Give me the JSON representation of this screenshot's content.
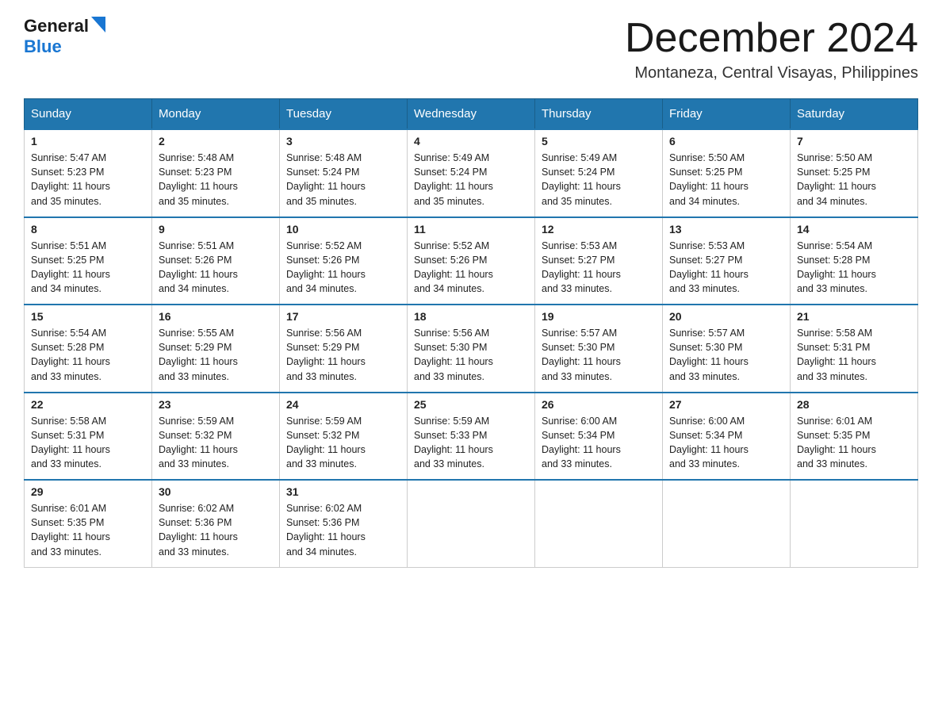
{
  "header": {
    "logo_general": "General",
    "logo_blue": "Blue",
    "month_title": "December 2024",
    "location": "Montaneza, Central Visayas, Philippines"
  },
  "weekdays": [
    "Sunday",
    "Monday",
    "Tuesday",
    "Wednesday",
    "Thursday",
    "Friday",
    "Saturday"
  ],
  "weeks": [
    [
      {
        "day": "1",
        "info": "Sunrise: 5:47 AM\nSunset: 5:23 PM\nDaylight: 11 hours\nand 35 minutes."
      },
      {
        "day": "2",
        "info": "Sunrise: 5:48 AM\nSunset: 5:23 PM\nDaylight: 11 hours\nand 35 minutes."
      },
      {
        "day": "3",
        "info": "Sunrise: 5:48 AM\nSunset: 5:24 PM\nDaylight: 11 hours\nand 35 minutes."
      },
      {
        "day": "4",
        "info": "Sunrise: 5:49 AM\nSunset: 5:24 PM\nDaylight: 11 hours\nand 35 minutes."
      },
      {
        "day": "5",
        "info": "Sunrise: 5:49 AM\nSunset: 5:24 PM\nDaylight: 11 hours\nand 35 minutes."
      },
      {
        "day": "6",
        "info": "Sunrise: 5:50 AM\nSunset: 5:25 PM\nDaylight: 11 hours\nand 34 minutes."
      },
      {
        "day": "7",
        "info": "Sunrise: 5:50 AM\nSunset: 5:25 PM\nDaylight: 11 hours\nand 34 minutes."
      }
    ],
    [
      {
        "day": "8",
        "info": "Sunrise: 5:51 AM\nSunset: 5:25 PM\nDaylight: 11 hours\nand 34 minutes."
      },
      {
        "day": "9",
        "info": "Sunrise: 5:51 AM\nSunset: 5:26 PM\nDaylight: 11 hours\nand 34 minutes."
      },
      {
        "day": "10",
        "info": "Sunrise: 5:52 AM\nSunset: 5:26 PM\nDaylight: 11 hours\nand 34 minutes."
      },
      {
        "day": "11",
        "info": "Sunrise: 5:52 AM\nSunset: 5:26 PM\nDaylight: 11 hours\nand 34 minutes."
      },
      {
        "day": "12",
        "info": "Sunrise: 5:53 AM\nSunset: 5:27 PM\nDaylight: 11 hours\nand 33 minutes."
      },
      {
        "day": "13",
        "info": "Sunrise: 5:53 AM\nSunset: 5:27 PM\nDaylight: 11 hours\nand 33 minutes."
      },
      {
        "day": "14",
        "info": "Sunrise: 5:54 AM\nSunset: 5:28 PM\nDaylight: 11 hours\nand 33 minutes."
      }
    ],
    [
      {
        "day": "15",
        "info": "Sunrise: 5:54 AM\nSunset: 5:28 PM\nDaylight: 11 hours\nand 33 minutes."
      },
      {
        "day": "16",
        "info": "Sunrise: 5:55 AM\nSunset: 5:29 PM\nDaylight: 11 hours\nand 33 minutes."
      },
      {
        "day": "17",
        "info": "Sunrise: 5:56 AM\nSunset: 5:29 PM\nDaylight: 11 hours\nand 33 minutes."
      },
      {
        "day": "18",
        "info": "Sunrise: 5:56 AM\nSunset: 5:30 PM\nDaylight: 11 hours\nand 33 minutes."
      },
      {
        "day": "19",
        "info": "Sunrise: 5:57 AM\nSunset: 5:30 PM\nDaylight: 11 hours\nand 33 minutes."
      },
      {
        "day": "20",
        "info": "Sunrise: 5:57 AM\nSunset: 5:30 PM\nDaylight: 11 hours\nand 33 minutes."
      },
      {
        "day": "21",
        "info": "Sunrise: 5:58 AM\nSunset: 5:31 PM\nDaylight: 11 hours\nand 33 minutes."
      }
    ],
    [
      {
        "day": "22",
        "info": "Sunrise: 5:58 AM\nSunset: 5:31 PM\nDaylight: 11 hours\nand 33 minutes."
      },
      {
        "day": "23",
        "info": "Sunrise: 5:59 AM\nSunset: 5:32 PM\nDaylight: 11 hours\nand 33 minutes."
      },
      {
        "day": "24",
        "info": "Sunrise: 5:59 AM\nSunset: 5:32 PM\nDaylight: 11 hours\nand 33 minutes."
      },
      {
        "day": "25",
        "info": "Sunrise: 5:59 AM\nSunset: 5:33 PM\nDaylight: 11 hours\nand 33 minutes."
      },
      {
        "day": "26",
        "info": "Sunrise: 6:00 AM\nSunset: 5:34 PM\nDaylight: 11 hours\nand 33 minutes."
      },
      {
        "day": "27",
        "info": "Sunrise: 6:00 AM\nSunset: 5:34 PM\nDaylight: 11 hours\nand 33 minutes."
      },
      {
        "day": "28",
        "info": "Sunrise: 6:01 AM\nSunset: 5:35 PM\nDaylight: 11 hours\nand 33 minutes."
      }
    ],
    [
      {
        "day": "29",
        "info": "Sunrise: 6:01 AM\nSunset: 5:35 PM\nDaylight: 11 hours\nand 33 minutes."
      },
      {
        "day": "30",
        "info": "Sunrise: 6:02 AM\nSunset: 5:36 PM\nDaylight: 11 hours\nand 33 minutes."
      },
      {
        "day": "31",
        "info": "Sunrise: 6:02 AM\nSunset: 5:36 PM\nDaylight: 11 hours\nand 34 minutes."
      },
      {
        "day": "",
        "info": ""
      },
      {
        "day": "",
        "info": ""
      },
      {
        "day": "",
        "info": ""
      },
      {
        "day": "",
        "info": ""
      }
    ]
  ]
}
